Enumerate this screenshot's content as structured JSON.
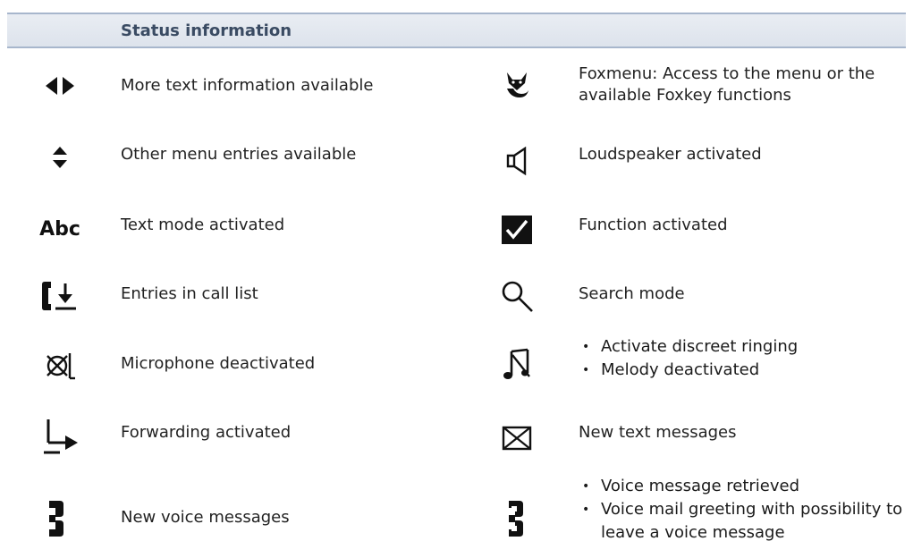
{
  "header": {
    "title": "Status information"
  },
  "left_items": [
    {
      "icon": "left-right-arrows-icon",
      "label": "More text information available"
    },
    {
      "icon": "up-down-arrows-icon",
      "label": "Other menu entries available"
    },
    {
      "icon": "text-mode-icon",
      "icon_text": "Abc",
      "label": "Text mode activated"
    },
    {
      "icon": "call-list-icon",
      "label": "Entries in call list"
    },
    {
      "icon": "microphone-off-icon",
      "label": "Microphone deactivated"
    },
    {
      "icon": "forwarding-icon",
      "label": "Forwarding activated"
    },
    {
      "icon": "voice-message-icon",
      "label": "New voice messages"
    }
  ],
  "right_items": [
    {
      "icon": "fox-icon",
      "label": "Foxmenu: Access to the menu or the available Foxkey functions"
    },
    {
      "icon": "loudspeaker-icon",
      "label": "Loudspeaker activated"
    },
    {
      "icon": "checkbox-checked-icon",
      "label": "Function activated"
    },
    {
      "icon": "search-icon",
      "label": "Search mode"
    },
    {
      "icon": "melody-off-icon",
      "bullets": [
        "Activate discreet ringing",
        "Melody deactivated"
      ]
    },
    {
      "icon": "envelope-icon",
      "label": "New text messages"
    },
    {
      "icon": "voice-message-retrieved-icon",
      "bullets": [
        "Voice message retrieved",
        "Voice mail greeting with possibility to leave a voice message"
      ]
    }
  ]
}
